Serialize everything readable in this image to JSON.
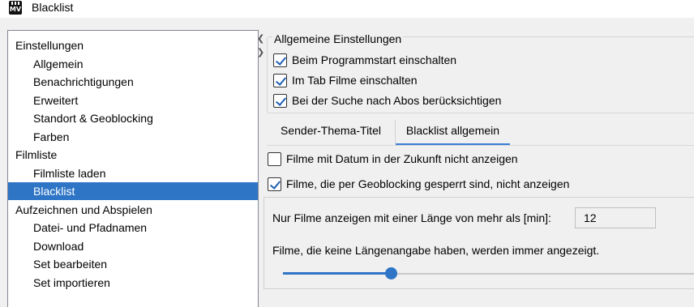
{
  "window": {
    "title": "Blacklist",
    "app_icon": "mediathekview-icon"
  },
  "tree": {
    "items": [
      {
        "label": "Einstellungen",
        "level": 0,
        "selected": false
      },
      {
        "label": "Allgemein",
        "level": 1,
        "selected": false
      },
      {
        "label": "Benachrichtigungen",
        "level": 1,
        "selected": false
      },
      {
        "label": "Erweitert",
        "level": 1,
        "selected": false
      },
      {
        "label": "Standort & Geoblocking",
        "level": 1,
        "selected": false
      },
      {
        "label": "Farben",
        "level": 1,
        "selected": false
      },
      {
        "label": "Filmliste",
        "level": 0,
        "selected": false
      },
      {
        "label": "Filmliste laden",
        "level": 1,
        "selected": false
      },
      {
        "label": "Blacklist",
        "level": 1,
        "selected": true
      },
      {
        "label": "Aufzeichnen und Abspielen",
        "level": 0,
        "selected": false
      },
      {
        "label": "Datei- und Pfadnamen",
        "level": 1,
        "selected": false
      },
      {
        "label": "Download",
        "level": 1,
        "selected": false
      },
      {
        "label": "Set bearbeiten",
        "level": 1,
        "selected": false
      },
      {
        "label": "Set importieren",
        "level": 1,
        "selected": false
      }
    ]
  },
  "general": {
    "title": "Allgemeine Einstellungen",
    "options": [
      {
        "label": "Beim Programmstart einschalten",
        "checked": true
      },
      {
        "label": "Im Tab Filme einschalten",
        "checked": true
      },
      {
        "label": "Bei der Suche nach Abos berücksichtigen",
        "checked": true
      }
    ]
  },
  "tabs": [
    {
      "label": "Sender-Thema-Titel",
      "active": false
    },
    {
      "label": "Blacklist allgemein",
      "active": true
    }
  ],
  "blacklist_general": {
    "options": [
      {
        "label": "Filme mit Datum in der Zukunft nicht anzeigen",
        "checked": false
      },
      {
        "label": "Filme, die per Geoblocking gesperrt sind, nicht anzeigen",
        "checked": true
      }
    ],
    "length_label": "Nur Filme anzeigen mit einer Länge von mehr als [min]:",
    "length_value": "12",
    "info_text": "Filme, die keine Längenangabe haben, werden immer angezeigt.",
    "slider_fraction": 0.264
  },
  "colors": {
    "accent": "#2e75c6",
    "selection": "#2e75c6"
  }
}
